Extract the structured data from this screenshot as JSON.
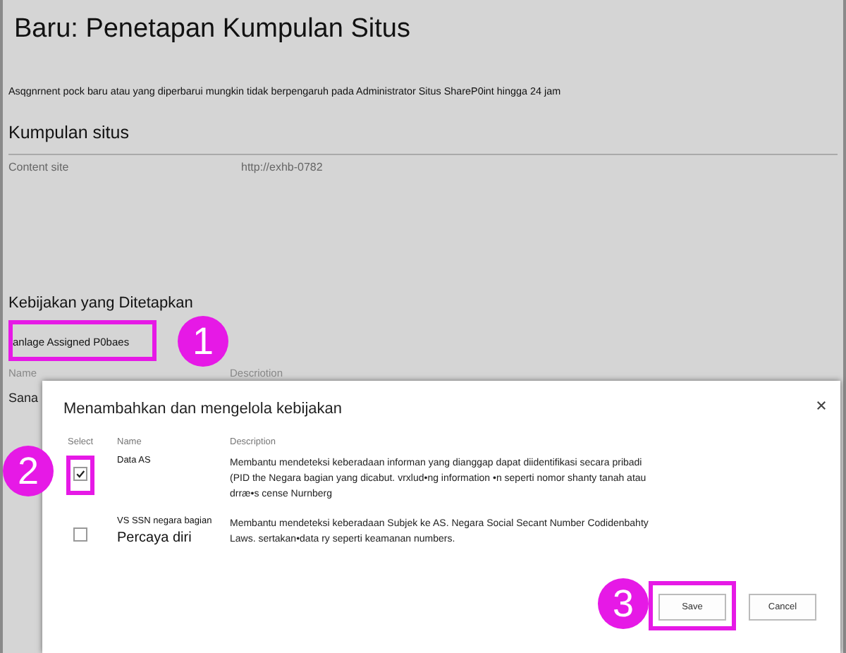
{
  "page": {
    "title": "Baru:  Penetapan Kumpulan Situs",
    "notice": "Asqgnrnent pock baru atau yang diperbarui mungkin tidak berpengaruh pada Administrator Situs ShareP0int hingga 24 jam",
    "site_section": {
      "heading": "Kumpulan situs",
      "fields": [
        {
          "label": "Content site",
          "value": "http://exhb-0782"
        }
      ]
    },
    "policy_section": {
      "heading": "Kebijakan yang Ditetapkan",
      "link": {
        "label": "anlage Assigned P0baes",
        "highlighted": true
      },
      "columns": [
        "Name",
        "Descriotion"
      ],
      "row_name": "Sana"
    }
  },
  "dialog": {
    "title": "Menambahkan dan mengelola kebijakan",
    "columns": [
      "Select",
      "Name",
      "Description"
    ],
    "rows": [
      {
        "name": "Data AS",
        "subtitle": null,
        "description": "Membantu mendeteksi keberadaan informan yang dianggap dapat diidentifikasi secara pribadi (PID the Negara bagian yang dicabut. vrxlud•ng information •n seperti nomor shanty tanah atau drræ•s cense Nurnberg",
        "checked": true,
        "highlighted": true
      },
      {
        "name": "VS SSN negara bagian",
        "subtitle": "Percaya diri",
        "description": "Membantu mendeteksi keberadaan Subjek ke AS. Negara Social Secant Number Codidenbahty Laws. sertakan•data ry seperti keamanan numbers.",
        "checked": false,
        "highlighted": false
      }
    ],
    "buttons": [
      {
        "label": "Save",
        "highlighted": true
      },
      {
        "label": "Cancel",
        "highlighted": false
      }
    ]
  },
  "callouts": [
    {
      "number": "1"
    },
    {
      "number": "2"
    },
    {
      "number": "3"
    }
  ]
}
